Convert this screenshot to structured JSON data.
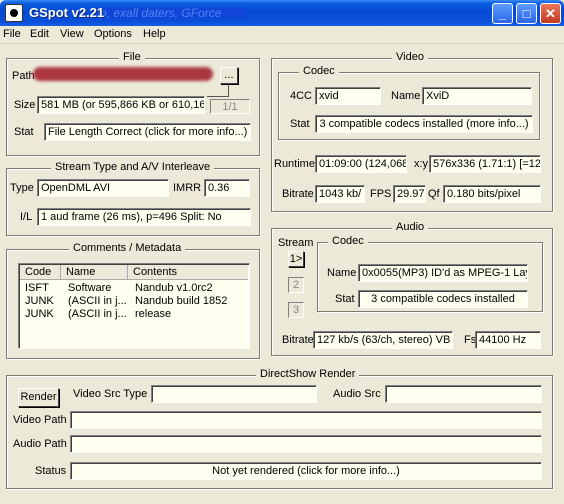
{
  "window": {
    "title": "GSpot v2.21",
    "title_ghost": "p, exall daters, GForce"
  },
  "menus": [
    "File",
    "Edit",
    "View",
    "Options",
    "Help"
  ],
  "file": {
    "group_label": "File",
    "path_label": "Path",
    "browse_label": "...",
    "size_label": "Size",
    "size_value": "581 MB (or 595,866 KB or 610,16",
    "part_label": "1/1",
    "stat_label": "Stat",
    "stat_value": "File Length Correct (click for more info...)"
  },
  "stream": {
    "group_label": "Stream Type and A/V Interleave",
    "type_label": "Type",
    "type_value": "OpenDML AVI",
    "imrr_label": "IMRR",
    "imrr_value": "0.36",
    "il_label": "I/L",
    "il_value": "1 aud frame (26 ms), p=496  Split: No"
  },
  "comments": {
    "group_label": "Comments / Metadata",
    "columns": [
      "Code",
      "Name",
      "Contents"
    ],
    "rows": [
      [
        "ISFT",
        "Software",
        "Nandub v1.0rc2"
      ],
      [
        "JUNK",
        "(ASCII in j...",
        "Nandub build 1852"
      ],
      [
        "JUNK",
        "(ASCII in j...",
        "release"
      ]
    ]
  },
  "video": {
    "group_label": "Video",
    "codec_group_label": "Codec",
    "fourcc_label": "4CC",
    "fourcc_value": "xvid",
    "name_label": "Name",
    "name_value": "XviD",
    "stat_label": "Stat",
    "stat_value": "3 compatible codecs installed (more info...)",
    "runtime_label": "Runtime",
    "runtime_value": "01:09:00 (124,068",
    "xy_label": "x:y",
    "xy_value": "576x336 (1.71:1) [=12",
    "bitrate_label": "Bitrate",
    "bitrate_value": "1043 kb/",
    "fps_label": "FPS",
    "fps_value": "29.97",
    "qf_label": "Qf",
    "qf_value": "0.180 bits/pixel"
  },
  "audio": {
    "group_label": "Audio",
    "stream_label": "Stream",
    "stream_buttons": [
      "1>",
      "2",
      "3"
    ],
    "codec_group_label": "Codec",
    "name_label": "Name",
    "name_value": "0x0055(MP3) ID'd as MPEG-1 Lay",
    "stat_label": "Stat",
    "stat_value": "3 compatible codecs installed",
    "bitrate_label": "Bitrate",
    "bitrate_value": "127 kb/s (63/ch, stereo) VB",
    "fs_label": "Fs",
    "fs_value": "44100 Hz"
  },
  "directshow": {
    "group_label": "DirectShow Render",
    "render_label": "Render",
    "video_src_type_label": "Video Src Type",
    "video_src_type_value": "",
    "audio_src_label": "Audio Src",
    "audio_src_value": "",
    "video_path_label": "Video Path",
    "video_path_value": "",
    "audio_path_label": "Audio Path",
    "audio_path_value": "",
    "status_label": "Status",
    "status_value": "Not yet rendered (click for more info...)"
  }
}
